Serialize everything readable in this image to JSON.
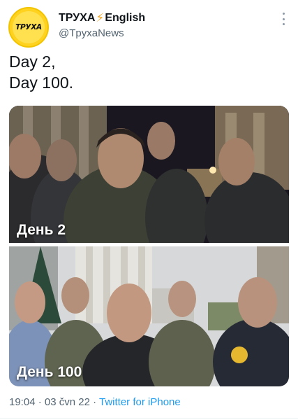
{
  "account": {
    "avatar_text": "ТРУХА",
    "name_prefix": "ТРУХА",
    "name_bolt": "⚡",
    "name_suffix": "English",
    "handle": "@TpyxaNews",
    "brand_color": "#ffd21f"
  },
  "tweet": {
    "text": "Day 2,\nDay 100."
  },
  "media": {
    "photo_top_caption": "День 2",
    "photo_bottom_caption": "День 100"
  },
  "meta": {
    "time": "19:04",
    "separator1": " · ",
    "date": "03 čvn 22",
    "separator2": " · ",
    "source": "Twitter for iPhone",
    "source_color": "#1d9bf0"
  },
  "icons": {
    "more": "more-vertical-icon"
  }
}
